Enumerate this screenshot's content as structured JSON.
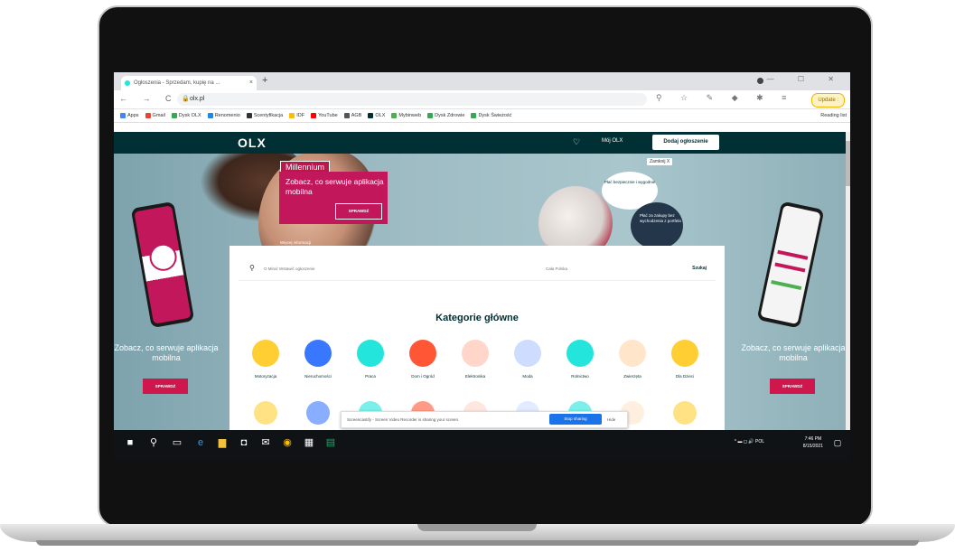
{
  "browser": {
    "tab_title": "Ogłoszenia - Sprzedam, kupię na ...",
    "tab_close": "×",
    "new_tab": "+",
    "window_controls": "— ☐ ✕",
    "nav_buttons": "← → C ⌂",
    "url": "olx.pl",
    "update_label": "Update :",
    "bookmarks": [
      {
        "label": "Apps",
        "color": "#4285f4"
      },
      {
        "label": "Gmail",
        "color": "#ea4335"
      },
      {
        "label": "Dysk OLX",
        "color": "#34a853"
      },
      {
        "label": "Renomenio",
        "color": "#1e88e5"
      },
      {
        "label": "Scentyfikacja",
        "color": "#333333"
      },
      {
        "label": "IDF",
        "color": "#fbbc05"
      },
      {
        "label": "YouTube",
        "color": "#ff0000"
      },
      {
        "label": "AGB",
        "color": "#555555"
      },
      {
        "label": "OLX",
        "color": "#002f34"
      },
      {
        "label": "Mybinweb",
        "color": "#4caf50"
      },
      {
        "label": "Dysk Zdrowie",
        "color": "#34a853"
      },
      {
        "label": "Dysk Świeżość",
        "color": "#34a853"
      }
    ],
    "reading_list": "Reading list"
  },
  "olx": {
    "logo": "OLX",
    "heart": "♡",
    "account": "Mój OLX",
    "add_listing": "Dodaj ogłoszenie",
    "millennium": "Millennium",
    "promo_text": "Zobacz, co serwuje aplikacja mobilna",
    "promo_button": "SPRAWDŹ",
    "more_info": "Więcej informacji",
    "close_label": "Zamknij X",
    "bubble1": "Płać bezpiecznie i wygodnie",
    "bubble2": "Płać za zakupy bez wychodzenia z portfela",
    "search_placeholder": "O Miraż Wstawić ogłoszenie",
    "location_placeholder": "Cała Polska",
    "search_go": "Szukaj",
    "categories_title": "Kategorie główne",
    "categories": [
      {
        "label": "Motoryzacja",
        "color": "#ffce32"
      },
      {
        "label": "Nieruchomości",
        "color": "#3a77ff"
      },
      {
        "label": "Praca",
        "color": "#23e5db"
      },
      {
        "label": "Dom i Ogród",
        "color": "#ff5636"
      },
      {
        "label": "Elektronika",
        "color": "#ffd6c9"
      },
      {
        "label": "Moda",
        "color": "#ceddff"
      },
      {
        "label": "Rolnictwo",
        "color": "#23e5db"
      },
      {
        "label": "Zwierzęta",
        "color": "#ffe5c9"
      },
      {
        "label": "Dla Dzieci",
        "color": "#ffce32"
      }
    ],
    "side_promo_left": "Zobacz, co serwuje aplikacja mobilna",
    "side_promo_right": "Zobacz, co serwuje aplikacja mobilna",
    "side_button": "SPRAWDŹ"
  },
  "share_bar": {
    "text": "Screencastify - Screen Video Recorder is sharing your screen.",
    "stop": "Stop sharing",
    "hide": "Hide"
  },
  "taskbar": {
    "clock_time": "7:46 PM",
    "clock_date": "8/15/2021",
    "tray": "^ ▬ ◻ 🔊 POL"
  }
}
